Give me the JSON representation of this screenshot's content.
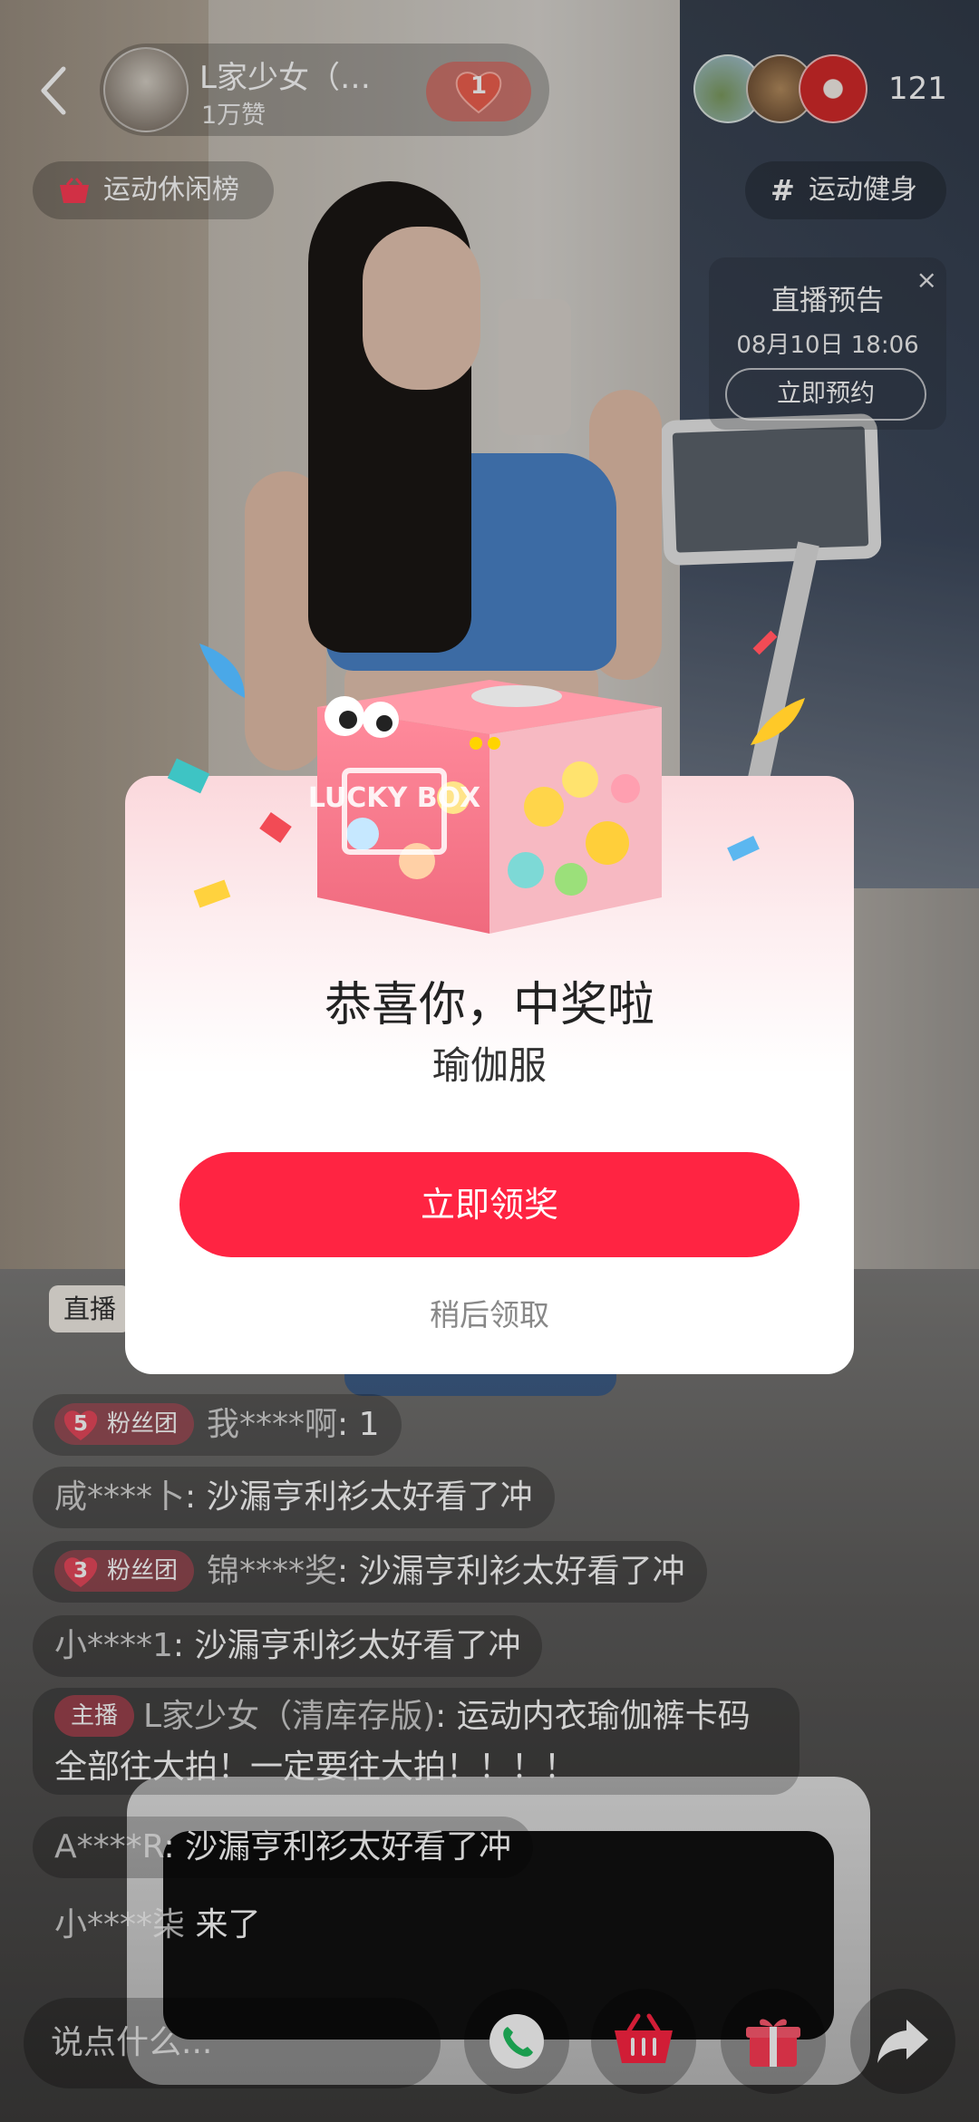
{
  "streamer": {
    "name": "L家少女（…",
    "likes": "1万赞",
    "fan_level": "1"
  },
  "viewer_count": "121",
  "tags": {
    "rank": "运动休闲榜",
    "topic": "运动健身"
  },
  "live_preview": {
    "title": "直播预告",
    "time": "08月10日 18:06",
    "button": "立即预约",
    "close": "×"
  },
  "chat": {
    "live_pill": "直播",
    "messages": [
      {
        "fan_level": "5",
        "fan_label": "粉丝团",
        "user": "我****啊",
        "text": ": 1"
      },
      {
        "user": "咸****卜",
        "text": ": 沙漏亨利衫太好看了冲"
      },
      {
        "fan_level": "3",
        "fan_label": "粉丝团",
        "user": "锦****奖",
        "text": ": 沙漏亨利衫太好看了冲"
      },
      {
        "user": "小****1",
        "text": ": 沙漏亨利衫太好看了冲"
      },
      {
        "host_label": "主播",
        "user": "L家少女（清库存版)",
        "text": ": 运动内衣瑜伽裤卡码全部往大拍！一定要往大拍！！！！"
      },
      {
        "user": "A****R",
        "text": ": 沙漏亨利衫太好看了冲"
      },
      {
        "user": "小****柒",
        "text": " 来了"
      }
    ]
  },
  "bottom_bar": {
    "input_placeholder": "说点什么..."
  },
  "modal": {
    "box_label": "LUCKY BOX",
    "title": "恭喜你，中奖啦",
    "prize": "瑜伽服",
    "claim_button": "立即领奖",
    "later_button": "稍后领取"
  },
  "colors": {
    "accent": "#ff2442",
    "modal_top": "#fbd8dc"
  }
}
